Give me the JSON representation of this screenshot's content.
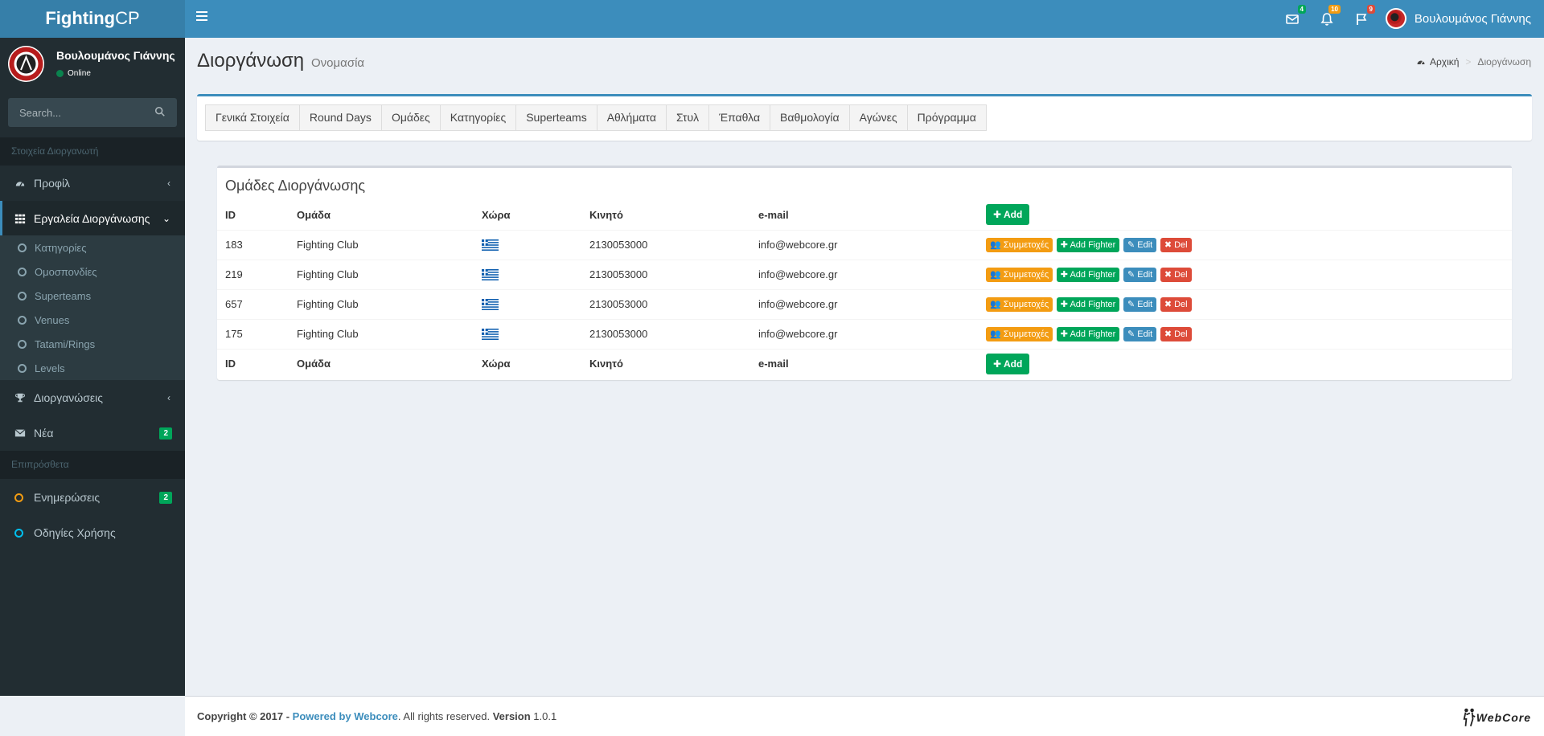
{
  "header": {
    "logo_bold": "Fighting",
    "logo_light": "CP",
    "messages_count": "4",
    "notifications_count": "10",
    "tasks_count": "9",
    "user_name": "Βουλουμάνος Γιάννης"
  },
  "sidebar": {
    "user_name": "Βουλουμάνος Γιάννης",
    "status": "Online",
    "search_placeholder": "Search...",
    "section1": "Στοιχεία Διοργανωτή",
    "profile": "Προφίλ",
    "tools": "Εργαλεία Διοργάνωσης",
    "sub_items": [
      "Κατηγορίες",
      "Ομοσπονδίες",
      "Superteams",
      "Venues",
      "Tatami/Rings",
      "Levels"
    ],
    "tournaments": "Διοργανώσεις",
    "news": "Νέα",
    "news_count": "2",
    "section2": "Επιπρόσθετα",
    "updates": "Ενημερώσεις",
    "updates_count": "2",
    "guide": "Οδηγίες Χρήσης"
  },
  "content": {
    "title": "Διοργάνωση",
    "subtitle": "Ονομασία",
    "breadcrumb_home": "Αρχική",
    "breadcrumb_current": "Διοργάνωση"
  },
  "tabs": [
    "Γενικά Στοιχεία",
    "Round Days",
    "Ομάδες",
    "Κατηγορίες",
    "Superteams",
    "Αθλήματα",
    "Στυλ",
    "Έπαθλα",
    "Βαθμολογία",
    "Αγώνες",
    "Πρόγραμμα"
  ],
  "groups": {
    "title": "Ομάδες Διοργάνωσης",
    "columns": [
      "ID",
      "Ομάδα",
      "Χώρα",
      "Κινητό",
      "e-mail"
    ],
    "add_label": "Add",
    "participations_label": "Συμμετοχές",
    "add_fighter_label": "Add Fighter",
    "edit_label": "Edit",
    "delete_label": "Del",
    "rows": [
      {
        "id": "183",
        "team": "Fighting Club",
        "phone": "2130053000",
        "email": "info@webcore.gr"
      },
      {
        "id": "219",
        "team": "Fighting Club",
        "phone": "2130053000",
        "email": "info@webcore.gr"
      },
      {
        "id": "657",
        "team": "Fighting Club",
        "phone": "2130053000",
        "email": "info@webcore.gr"
      },
      {
        "id": "175",
        "team": "Fighting Club",
        "phone": "2130053000",
        "email": "info@webcore.gr"
      }
    ]
  },
  "footer": {
    "copyright": "Copyright © 2017 - ",
    "powered": "Powered by Webcore",
    "rights": ". All rights reserved. ",
    "version_label": "Version",
    "version": " 1.0.1",
    "logo_text": "WebCore"
  },
  "colors": {
    "primary": "#3c8dbc",
    "success": "#00a65a",
    "warning": "#f39c12",
    "danger": "#dd4b39",
    "sidebar_bg": "#222d32"
  }
}
